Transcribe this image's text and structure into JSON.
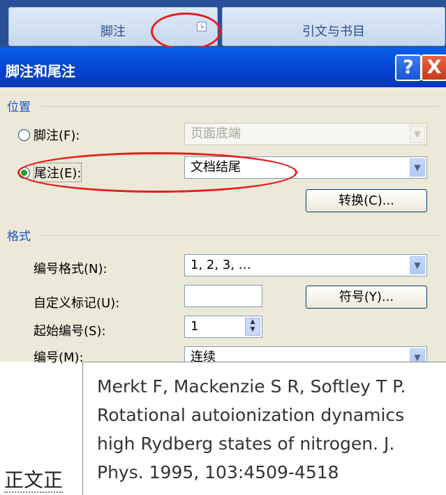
{
  "ribbon": {
    "footnote_group_label": "脚注",
    "citation_group_label": "引文与书目"
  },
  "dialog": {
    "title": "脚注和尾注",
    "help_glyph": "?",
    "close_glyph": "X",
    "location": {
      "heading": "位置",
      "footnote_label": "脚注(F):",
      "footnote_value": "页面底端",
      "endnote_label": "尾注(E):",
      "endnote_value": "文档结尾",
      "convert_button": "转换(C)..."
    },
    "format": {
      "heading": "格式",
      "number_format_label": "编号格式(N):",
      "number_format_value": "1, 2, 3, …",
      "custom_mark_label": "自定义标记(U):",
      "custom_mark_value": "",
      "symbol_button": "符号(Y)...",
      "start_at_label": "起始编号(S):",
      "start_at_value": "1",
      "numbering_label": "编号(M):",
      "numbering_value": "连续"
    },
    "selected_location": "endnote"
  },
  "document": {
    "body_text": "正文正"
  },
  "tooltip": {
    "lines": [
      "Merkt F, Mackenzie S R, Softley T P.",
      "Rotational autoionization dynamics",
      "high Rydberg states of nitrogen. J.",
      "Phys. 1995, 103:4509-4518"
    ]
  },
  "colors": {
    "annotation_red": "#e41f1f",
    "titlebar_blue": "#0545d1",
    "radio_selected": "#21a121"
  }
}
